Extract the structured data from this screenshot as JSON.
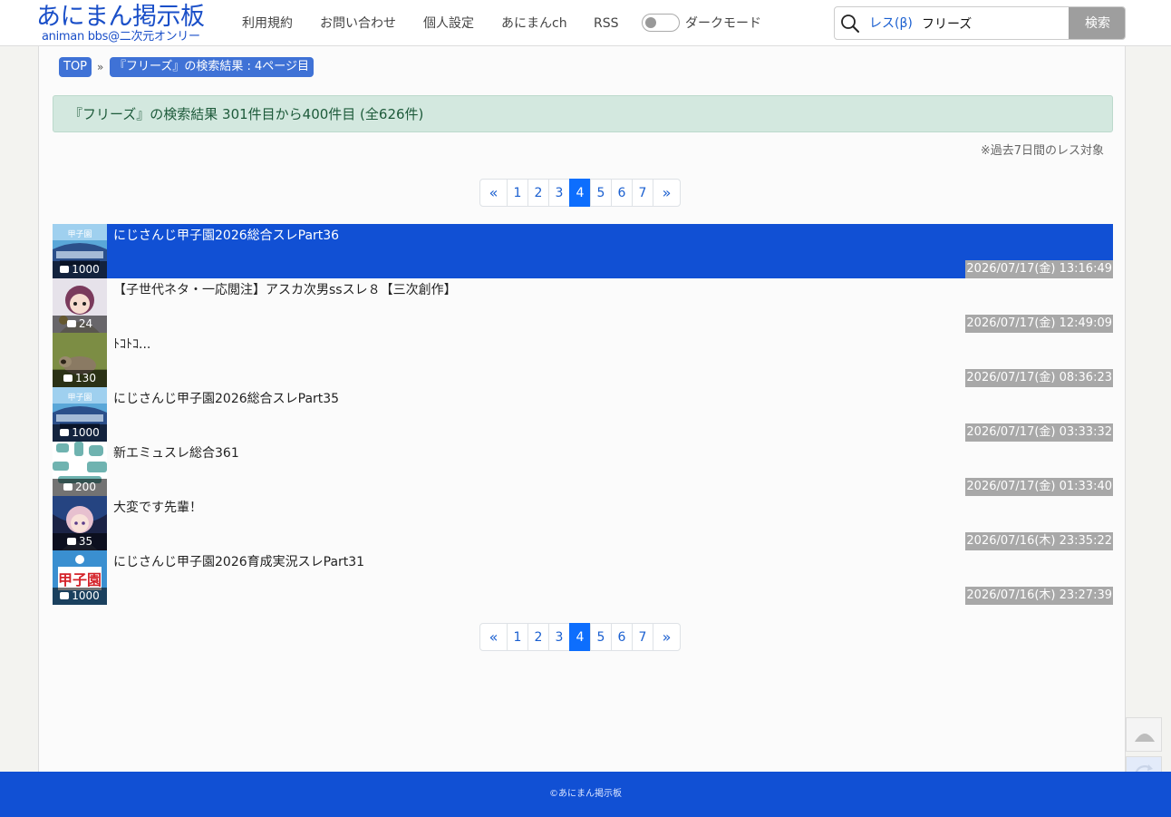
{
  "logo": {
    "main": "あにまん掲示板",
    "sub": "animan bbs@二次元オンリー"
  },
  "nav": {
    "items": [
      "利用規約",
      "お問い合わせ",
      "個人設定",
      "あにまんch",
      "RSS"
    ],
    "dark_mode_label": "ダークモード",
    "dark_mode_on": false
  },
  "search": {
    "scope": "レス(β)",
    "value": "フリーズ",
    "button": "検索"
  },
  "breadcrumb": {
    "top": "TOP",
    "separator": "»",
    "current": "『フリーズ』の検索結果 : 4ページ目"
  },
  "result_summary": "『フリーズ』の検索結果 301件目から400件目 (全626件)",
  "note": "※過去7日間のレス対象",
  "pagination": {
    "prev": "«",
    "next": "»",
    "pages": [
      "1",
      "2",
      "3",
      "4",
      "5",
      "6",
      "7"
    ],
    "current": "4"
  },
  "threads": [
    {
      "title": "にじさんじ甲子園2026総合スレPart36",
      "count": "1000",
      "date": "2026/07/17(金) 13:16:49",
      "highlighted": true,
      "thumb": "stadium"
    },
    {
      "title": "【子世代ネタ・一応閲注】アスカ次男ssスレ８【三次創作】",
      "count": "24",
      "date": "2026/07/17(金) 12:49:09",
      "highlighted": false,
      "thumb": "anime-girl"
    },
    {
      "title": "ﾄｺﾄｺ...",
      "count": "130",
      "date": "2026/07/17(金) 08:36:23",
      "highlighted": false,
      "thumb": "raccoon-dog"
    },
    {
      "title": "にじさんじ甲子園2026総合スレPart35",
      "count": "1000",
      "date": "2026/07/17(金) 03:33:32",
      "highlighted": false,
      "thumb": "stadium"
    },
    {
      "title": "新エミュスレ総合361",
      "count": "200",
      "date": "2026/07/17(金) 01:33:40",
      "highlighted": false,
      "thumb": "logo-teal"
    },
    {
      "title": "大変です先輩！",
      "count": "35",
      "date": "2026/07/16(木) 23:35:22",
      "highlighted": false,
      "thumb": "anime-character"
    },
    {
      "title": "にじさんじ甲子園2026育成実況スレPart31",
      "count": "1000",
      "date": "2026/07/16(木) 23:27:39",
      "highlighted": false,
      "thumb": "koshien-logo"
    }
  ],
  "side_buttons": [
    "scroll-top",
    "reload"
  ],
  "footer": "©あにまん掲示板",
  "colors": {
    "brand": "#1150d4",
    "link": "#1a5fd0",
    "active_page": "#0d6efd",
    "alert_bg": "#d3e8df",
    "date_bg": "#a8a8a8"
  }
}
